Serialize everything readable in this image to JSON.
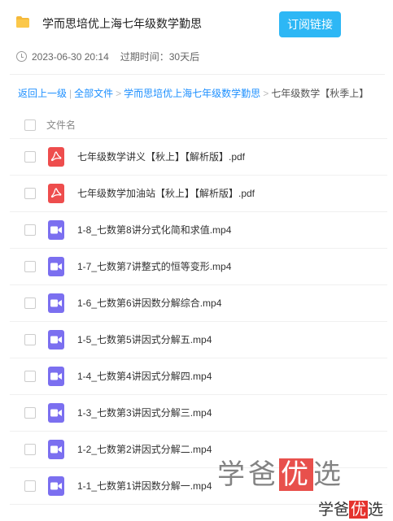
{
  "header": {
    "title": "学而思培优上海七年级数学勤思",
    "subscribe_label": "订阅链接",
    "date": "2023-06-30 20:14",
    "expire": "过期时间：30天后"
  },
  "breadcrumb": {
    "back": "返回上一级",
    "divider": "|",
    "all_files": "全部文件",
    "sep": ">",
    "folder": "学而思培优上海七年级数学勤思",
    "current": "七年级数学【秋季上】"
  },
  "list": {
    "column_header": "文件名",
    "files": [
      {
        "name": "七年级数学讲义【秋上】【解析版】.pdf",
        "type": "pdf"
      },
      {
        "name": "七年级数学加油站【秋上】【解析版】.pdf",
        "type": "pdf"
      },
      {
        "name": "1-8_七数第8讲分式化简和求值.mp4",
        "type": "video"
      },
      {
        "name": "1-7_七数第7讲整式的恒等变形.mp4",
        "type": "video"
      },
      {
        "name": "1-6_七数第6讲因数分解综合.mp4",
        "type": "video"
      },
      {
        "name": "1-5_七数第5讲因式分解五.mp4",
        "type": "video"
      },
      {
        "name": "1-4_七数第4讲因式分解四.mp4",
        "type": "video"
      },
      {
        "name": "1-3_七数第3讲因式分解三.mp4",
        "type": "video"
      },
      {
        "name": "1-2_七数第2讲因式分解二.mp4",
        "type": "video"
      },
      {
        "name": "1-1_七数第1讲因数分解一.mp4",
        "type": "video"
      }
    ]
  },
  "watermark": {
    "big_pre": "学爸",
    "big_hl": "优",
    "big_post": "选",
    "small_pre": "学爸",
    "small_hl": "优",
    "small_post": "选"
  },
  "colors": {
    "accent": "#2db7f5",
    "link": "#1e90ff",
    "pdf": "#ee4d4d",
    "video": "#7b6ff0",
    "watermark_highlight": "#e5322d"
  },
  "icons": {
    "folder": "folder-icon",
    "clock": "clock-icon",
    "pdf": "pdf-file-icon",
    "video": "video-file-icon"
  }
}
